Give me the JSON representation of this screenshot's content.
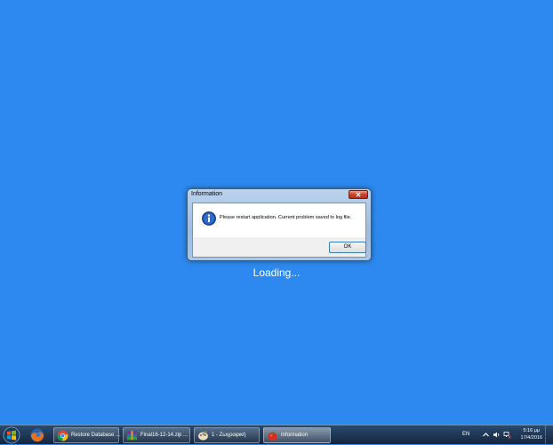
{
  "dialog": {
    "title": "Information",
    "close_label": "✕",
    "message": "Please restart application. Current problem saved to log file.",
    "ok_label": "OK"
  },
  "loading_text": "Loading...",
  "taskbar": {
    "tasks": [
      {
        "label": "Restore Database ...",
        "icon": "chrome-icon"
      },
      {
        "label": "Final16-12-14.zip ...",
        "icon": "winrar-icon"
      },
      {
        "label": "1 - Ζωγραφική",
        "icon": "paint-icon"
      },
      {
        "label": "Information",
        "icon": "app-tomato-icon"
      }
    ],
    "tray": {
      "language": "EN",
      "time": "5:16 μμ",
      "date": "17/4/2016"
    }
  },
  "colors": {
    "desktop": "#2d89ef",
    "taskbar": "#1c3553"
  }
}
